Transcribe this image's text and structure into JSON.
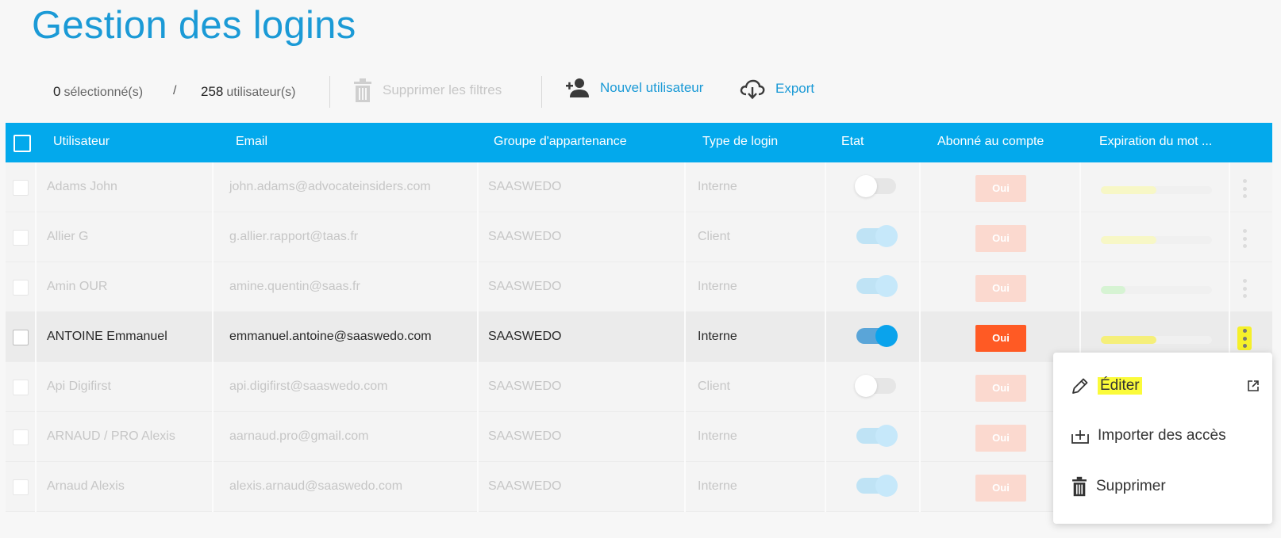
{
  "page_title": "Gestion des logins",
  "toolbar": {
    "selected_count": "0",
    "selected_label": "sélectionné(s)",
    "separator": "/",
    "total_count": "258",
    "total_label": "utilisateur(s)",
    "clear_filters_label": "Supprimer les filtres",
    "new_user_label": "Nouvel utilisateur",
    "export_label": "Export"
  },
  "table": {
    "headers": {
      "user": "Utilisateur",
      "email": "Email",
      "group": "Groupe d'appartenance",
      "login_type": "Type de login",
      "state": "Etat",
      "subscribed": "Abonné au compte",
      "expiration": "Expiration du mot ..."
    },
    "rows": [
      {
        "user": "Adams John",
        "email": "john.adams@advocateinsiders.com",
        "group": "SAASWEDO",
        "type": "Interne",
        "active": false,
        "subscribed": "Oui",
        "expiration_pct": 50,
        "bar_color": "#f7f7c6"
      },
      {
        "user": "Allier G",
        "email": "g.allier.rapport@taas.fr",
        "group": "SAASWEDO",
        "type": "Client",
        "active": true,
        "subscribed": "Oui",
        "expiration_pct": 50,
        "bar_color": "#f7f7c6"
      },
      {
        "user": "Amin OUR",
        "email": "amine.quentin@saas.fr",
        "group": "SAASWEDO",
        "type": "Interne",
        "active": true,
        "subscribed": "Oui",
        "expiration_pct": 22,
        "bar_color": "#d6f3d3"
      },
      {
        "user": "ANTOINE Emmanuel",
        "email": "emmanuel.antoine@saaswedo.com",
        "group": "SAASWEDO",
        "type": "Interne",
        "active": true,
        "subscribed": "Oui",
        "expiration_pct": 50,
        "bar_color": "#f5ef7a"
      },
      {
        "user": "Api Digifirst",
        "email": "api.digifirst@saaswedo.com",
        "group": "SAASWEDO",
        "type": "Client",
        "active": false,
        "subscribed": "Oui",
        "expiration_pct": 0,
        "bar_color": "#f7f7c6"
      },
      {
        "user": "ARNAUD / PRO Alexis",
        "email": "aarnaud.pro@gmail.com",
        "group": "SAASWEDO",
        "type": "Interne",
        "active": true,
        "subscribed": "Oui",
        "expiration_pct": 0,
        "bar_color": "#f7f7c6"
      },
      {
        "user": "Arnaud Alexis",
        "email": "alexis.arnaud@saaswedo.com",
        "group": "SAASWEDO",
        "type": "Interne",
        "active": true,
        "subscribed": "Oui",
        "expiration_pct": 0,
        "bar_color": "#f7f7c6"
      }
    ]
  },
  "context_menu": {
    "items": [
      "Éditer",
      "Importer des accès",
      "Supprimer"
    ]
  },
  "colors": {
    "accent": "#03a9ec",
    "title": "#1b9ad6",
    "badge_active": "#ff5a24",
    "highlight": "#fbfb3a"
  }
}
